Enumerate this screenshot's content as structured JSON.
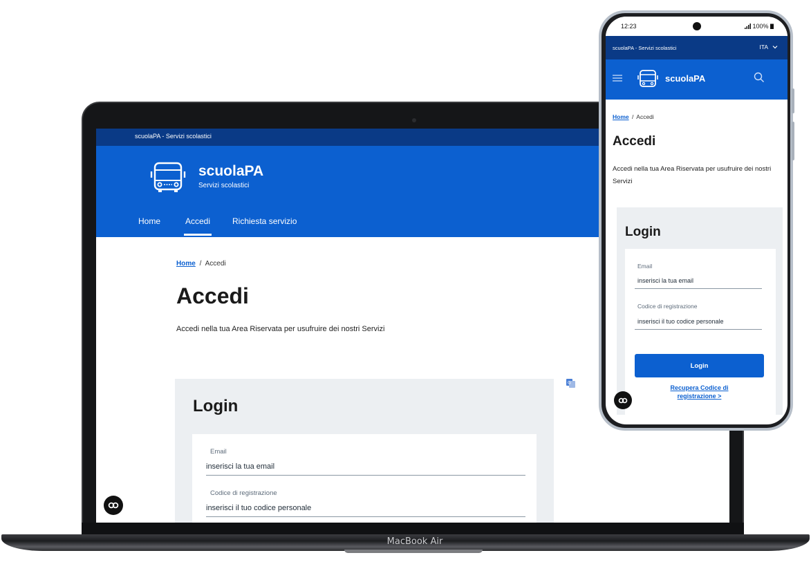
{
  "laptop": {
    "brand_label": "MacBook Air",
    "site": {
      "topbar_text": "scuolaPA - Servizi scolastici",
      "brand_title": "scuolaPA",
      "brand_subtitle": "Servizi scolastici",
      "nav": [
        {
          "label": "Home",
          "active": false
        },
        {
          "label": "Accedi",
          "active": true
        },
        {
          "label": "Richiesta servizio",
          "active": false
        }
      ],
      "breadcrumb": {
        "home": "Home",
        "separator": "/",
        "current": "Accedi"
      },
      "page_title": "Accedi",
      "description": "Accedi nella tua Area Riservata per usufruire dei nostri Servizi",
      "login": {
        "title": "Login",
        "email_label": "Email",
        "email_placeholder": "inserisci la tua email",
        "code_label": "Codice di registrazione",
        "code_placeholder": "inserisci il tuo codice personale"
      }
    }
  },
  "phone": {
    "status": {
      "time": "12:23",
      "battery": "100%"
    },
    "site": {
      "topbar_text": "scuolaPA - Servizi scolastici",
      "language": "ITA",
      "brand_title": "scuolaPA",
      "breadcrumb": {
        "home": "Home",
        "separator": "/",
        "current": "Accedi"
      },
      "page_title": "Accedi",
      "description": "Accedi nella tua Area Riservata per usufruire dei nostri Servizi",
      "login": {
        "title": "Login",
        "email_label": "Email",
        "email_placeholder": "inserisci la tua email",
        "code_label": "Codice di registrazione",
        "code_placeholder": "inserisci il tuo codice personale",
        "submit_label": "Login",
        "recover_line1": "Recupera Codice di",
        "recover_line2": "registrazione >"
      }
    }
  },
  "colors": {
    "primary_blue": "#0c60d0",
    "dark_blue": "#0a3a86",
    "card_grey": "#eceff2"
  },
  "icons": [
    "bus-logo-icon",
    "menu-icon",
    "search-icon",
    "chevron-down-icon",
    "translate-icon",
    "accessibility-badge-icon",
    "signal-icon",
    "battery-icon"
  ]
}
